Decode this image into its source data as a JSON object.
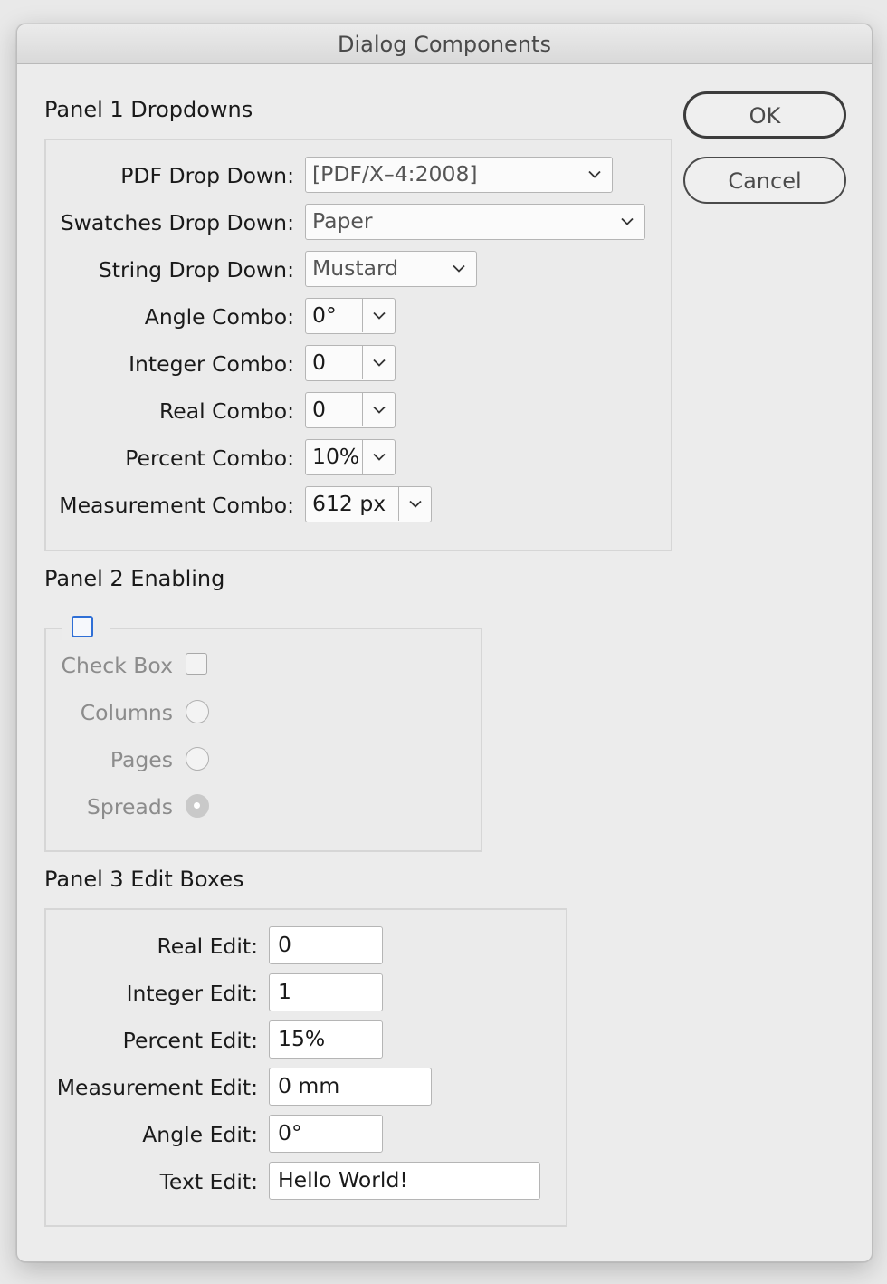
{
  "window": {
    "title": "Dialog Components"
  },
  "buttons": {
    "ok": "OK",
    "cancel": "Cancel"
  },
  "panel1": {
    "title": "Panel 1 Dropdowns",
    "rows": [
      {
        "label": "PDF Drop Down:",
        "value": "[PDF/X–4:2008]",
        "kind": "dropdown"
      },
      {
        "label": "Swatches Drop Down:",
        "value": "Paper",
        "kind": "dropdown"
      },
      {
        "label": "String Drop Down:",
        "value": "Mustard",
        "kind": "dropdown"
      },
      {
        "label": "Angle Combo:",
        "value": "0°",
        "kind": "combo"
      },
      {
        "label": "Integer Combo:",
        "value": "0",
        "kind": "combo"
      },
      {
        "label": "Real Combo:",
        "value": "0",
        "kind": "combo"
      },
      {
        "label": "Percent Combo:",
        "value": "10%",
        "kind": "combo"
      },
      {
        "label": "Measurement Combo:",
        "value": "612 px",
        "kind": "combo"
      }
    ]
  },
  "panel2": {
    "title": "Panel 2 Enabling",
    "enable_checked": false,
    "checkbox": {
      "label": "Check Box",
      "checked": false
    },
    "radios": [
      {
        "label": "Columns",
        "selected": false
      },
      {
        "label": "Pages",
        "selected": false
      },
      {
        "label": "Spreads",
        "selected": true
      }
    ]
  },
  "panel3": {
    "title": "Panel 3 Edit Boxes",
    "rows": [
      {
        "label": "Real Edit:",
        "value": "0"
      },
      {
        "label": "Integer Edit:",
        "value": "1"
      },
      {
        "label": "Percent Edit:",
        "value": "15%"
      },
      {
        "label": "Measurement Edit:",
        "value": "0 mm"
      },
      {
        "label": "Angle Edit:",
        "value": "0°"
      },
      {
        "label": "Text Edit:",
        "value": "Hello World!"
      }
    ]
  },
  "colors": {
    "window_bg": "#ececec",
    "panel_border": "#d6d6d6",
    "field_bg": "#fbfbfb",
    "enable_checkbox": "#2f6fd6",
    "disabled_text": "#8c8c8c"
  }
}
